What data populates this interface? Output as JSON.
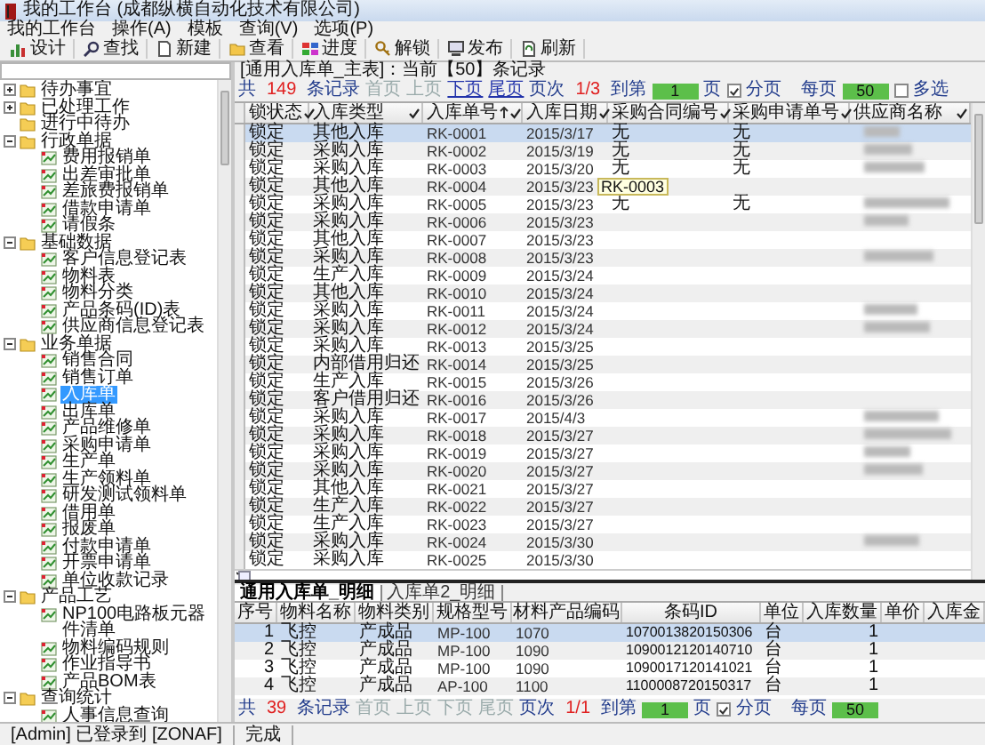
{
  "window": {
    "title": "我的工作台 (成都纵横自动化技术有限公司)"
  },
  "menu": [
    "我的工作台",
    "操作(A)",
    "模板",
    "查询(V)",
    "选项(P)"
  ],
  "toolbar": [
    "设计",
    "查找",
    "新建",
    "查看",
    "进度",
    "解锁",
    "发布",
    "刷新"
  ],
  "sidebar": {
    "tree": [
      {
        "label": "待办事宜",
        "kind": "folder",
        "expanded": false
      },
      {
        "label": "已处理工作",
        "kind": "folder",
        "expanded": false
      },
      {
        "label": "进行中待办",
        "kind": "folder"
      },
      {
        "label": "行政单据",
        "kind": "folder",
        "expanded": true,
        "children": [
          {
            "label": "费用报销单",
            "kind": "document",
            "selected": false
          },
          {
            "label": "出差审批单",
            "kind": "document",
            "selected": false
          },
          {
            "label": "差旅费报销单",
            "kind": "document",
            "selected": false
          },
          {
            "label": "借款申请单",
            "kind": "document",
            "selected": false
          },
          {
            "label": "请假条",
            "kind": "document",
            "selected": false
          }
        ]
      },
      {
        "label": "基础数据",
        "kind": "folder",
        "expanded": true,
        "children": [
          {
            "label": "客户信息登记表",
            "kind": "document",
            "selected": false
          },
          {
            "label": "物料表",
            "kind": "document",
            "selected": false
          },
          {
            "label": "物料分类",
            "kind": "document",
            "selected": false
          },
          {
            "label": "产品条码(ID)表",
            "kind": "document",
            "selected": false
          },
          {
            "label": "供应商信息登记表",
            "kind": "document",
            "selected": false
          }
        ]
      },
      {
        "label": "业务单据",
        "kind": "folder",
        "expanded": true,
        "children": [
          {
            "label": "销售合同",
            "kind": "document",
            "selected": false
          },
          {
            "label": "销售订单",
            "kind": "document",
            "selected": false
          },
          {
            "label": "入库单",
            "kind": "document",
            "selected": true
          },
          {
            "label": "出库单",
            "kind": "document",
            "selected": false
          },
          {
            "label": "产品维修单",
            "kind": "document",
            "selected": false
          },
          {
            "label": "采购申请单",
            "kind": "document",
            "selected": false
          },
          {
            "label": "生产单",
            "kind": "document",
            "selected": false
          },
          {
            "label": "生产领料单",
            "kind": "document",
            "selected": false
          },
          {
            "label": "研发测试领料单",
            "kind": "document",
            "selected": false
          },
          {
            "label": "借用单",
            "kind": "document",
            "selected": false
          },
          {
            "label": "报废单",
            "kind": "document",
            "selected": false
          },
          {
            "label": "付款申请单",
            "kind": "document",
            "selected": false
          },
          {
            "label": "开票申请单",
            "kind": "document",
            "selected": false
          },
          {
            "label": "单位收款记录",
            "kind": "document",
            "selected": false
          }
        ]
      },
      {
        "label": "产品工艺",
        "kind": "folder",
        "expanded": true,
        "children": [
          {
            "label": "NP100电路板元器件清单",
            "kind": "document",
            "selected": false
          },
          {
            "label": "物料编码规则",
            "kind": "document",
            "selected": false
          },
          {
            "label": "作业指导书",
            "kind": "document",
            "selected": false
          },
          {
            "label": "产品BOM表",
            "kind": "document",
            "selected": false
          }
        ]
      },
      {
        "label": "查询统计",
        "kind": "folder",
        "expanded": true,
        "children": [
          {
            "label": "人事信息查询",
            "kind": "document",
            "selected": false
          }
        ]
      }
    ]
  },
  "master": {
    "caption": "[通用入库单_主表]：当前【50】条记录",
    "pager": {
      "prefix": "共",
      "total": "149",
      "records_label": "条记录",
      "links": [
        {
          "label": "首页",
          "disabled": true
        },
        {
          "label": "上页",
          "disabled": true
        },
        {
          "label": "下页",
          "disabled": false
        },
        {
          "label": "尾页",
          "disabled": false
        }
      ],
      "page_label": "页次",
      "page": "1/3",
      "goto_label": "到第",
      "goto_value": "1",
      "page_unit": "页",
      "paging": {
        "label": "分页",
        "checked": true
      },
      "per_page_label": "每页",
      "per_page": "50",
      "multi": {
        "label": "多选",
        "checked": false
      }
    },
    "columns": [
      {
        "label": "锁状态",
        "sorted": false
      },
      {
        "label": "入库类型",
        "sorted": false
      },
      {
        "label": "入库单号",
        "sorted": true
      },
      {
        "label": "入库日期",
        "sorted": false
      },
      {
        "label": "采购合同编号",
        "sorted": false
      },
      {
        "label": "采购申请单号",
        "sorted": false
      },
      {
        "label": "供应商名称",
        "sorted": false
      }
    ],
    "rows": [
      {
        "lock": "锁定",
        "type": "其他入库",
        "no": "RK-0001",
        "date": "2015/3/17",
        "contract": "无",
        "request": "无",
        "supplier_blurred": true,
        "selected": true
      },
      {
        "lock": "锁定",
        "type": "采购入库",
        "no": "RK-0002",
        "date": "2015/3/19",
        "contract": "无",
        "request": "无",
        "supplier_blurred": true,
        "selected": false
      },
      {
        "lock": "锁定",
        "type": "采购入库",
        "no": "RK-0003",
        "date": "2015/3/20",
        "contract": "无",
        "request": "无",
        "supplier_blurred": true,
        "selected": false
      },
      {
        "lock": "锁定",
        "type": "其他入库",
        "no": "RK-0004",
        "date": "2015/3/23",
        "tooltip": "RK-0003",
        "supplier_blurred": false,
        "selected": false
      },
      {
        "lock": "锁定",
        "type": "采购入库",
        "no": "RK-0005",
        "date": "2015/3/23",
        "contract": "无",
        "request": "无",
        "supplier_blurred": true,
        "selected": false
      },
      {
        "lock": "锁定",
        "type": "采购入库",
        "no": "RK-0006",
        "date": "2015/3/23",
        "supplier_blurred": true,
        "selected": false
      },
      {
        "lock": "锁定",
        "type": "其他入库",
        "no": "RK-0007",
        "date": "2015/3/23",
        "supplier_blurred": false,
        "selected": false
      },
      {
        "lock": "锁定",
        "type": "采购入库",
        "no": "RK-0008",
        "date": "2015/3/23",
        "supplier_blurred": true,
        "selected": false
      },
      {
        "lock": "锁定",
        "type": "生产入库",
        "no": "RK-0009",
        "date": "2015/3/24",
        "supplier_blurred": false,
        "selected": false
      },
      {
        "lock": "锁定",
        "type": "其他入库",
        "no": "RK-0010",
        "date": "2015/3/24",
        "supplier_blurred": false,
        "selected": false
      },
      {
        "lock": "锁定",
        "type": "采购入库",
        "no": "RK-0011",
        "date": "2015/3/24",
        "supplier_blurred": true,
        "selected": false
      },
      {
        "lock": "锁定",
        "type": "采购入库",
        "no": "RK-0012",
        "date": "2015/3/24",
        "supplier_blurred": true,
        "selected": false
      },
      {
        "lock": "锁定",
        "type": "采购入库",
        "no": "RK-0013",
        "date": "2015/3/25",
        "supplier_blurred": false,
        "selected": false
      },
      {
        "lock": "锁定",
        "type": "内部借用归还",
        "no": "RK-0014",
        "date": "2015/3/25",
        "supplier_blurred": false,
        "selected": false
      },
      {
        "lock": "锁定",
        "type": "生产入库",
        "no": "RK-0015",
        "date": "2015/3/26",
        "supplier_blurred": false,
        "selected": false
      },
      {
        "lock": "锁定",
        "type": "客户借用归还",
        "no": "RK-0016",
        "date": "2015/3/26",
        "supplier_blurred": false,
        "selected": false
      },
      {
        "lock": "锁定",
        "type": "采购入库",
        "no": "RK-0017",
        "date": "2015/4/3",
        "supplier_blurred": true,
        "selected": false
      },
      {
        "lock": "锁定",
        "type": "采购入库",
        "no": "RK-0018",
        "date": "2015/3/27",
        "supplier_blurred": true,
        "selected": false
      },
      {
        "lock": "锁定",
        "type": "采购入库",
        "no": "RK-0019",
        "date": "2015/3/27",
        "supplier_blurred": true,
        "selected": false
      },
      {
        "lock": "锁定",
        "type": "采购入库",
        "no": "RK-0020",
        "date": "2015/3/27",
        "supplier_blurred": true,
        "selected": false
      },
      {
        "lock": "锁定",
        "type": "其他入库",
        "no": "RK-0021",
        "date": "2015/3/27",
        "supplier_blurred": false,
        "selected": false
      },
      {
        "lock": "锁定",
        "type": "生产入库",
        "no": "RK-0022",
        "date": "2015/3/27",
        "supplier_blurred": false,
        "selected": false
      },
      {
        "lock": "锁定",
        "type": "生产入库",
        "no": "RK-0023",
        "date": "2015/3/27",
        "supplier_blurred": false,
        "selected": false
      },
      {
        "lock": "锁定",
        "type": "采购入库",
        "no": "RK-0024",
        "date": "2015/3/30",
        "supplier_blurred": true,
        "selected": false
      },
      {
        "lock": "锁定",
        "type": "采购入库",
        "no": "RK-0025",
        "date": "2015/3/30",
        "supplier_blurred": false,
        "selected": false
      }
    ]
  },
  "detail": {
    "tabs": [
      {
        "label": "通用入库单_明细",
        "selected": true
      },
      {
        "label": "入库单2_明细",
        "selected": false
      }
    ],
    "columns": [
      "序号",
      "物料名称",
      "物料类别",
      "规格型号",
      "材料产品编码",
      "条码ID",
      "单位",
      "入库数量",
      "单价",
      "入库金"
    ],
    "rows": [
      {
        "seq": "1",
        "name": "飞控",
        "category": "产成品",
        "model": "MP-100",
        "code": "1070",
        "barcode": "1070013820150306",
        "unit": "台",
        "qty": "1",
        "selected": true
      },
      {
        "seq": "2",
        "name": "飞控",
        "category": "产成品",
        "model": "MP-100",
        "code": "1090",
        "barcode": "1090012120140710",
        "unit": "台",
        "qty": "1",
        "selected": false
      },
      {
        "seq": "3",
        "name": "飞控",
        "category": "产成品",
        "model": "MP-100",
        "code": "1090",
        "barcode": "1090017120141021",
        "unit": "台",
        "qty": "1",
        "selected": false
      },
      {
        "seq": "4",
        "name": "飞控",
        "category": "产成品",
        "model": "AP-100",
        "code": "1100",
        "barcode": "1100008720150317",
        "unit": "台",
        "qty": "1",
        "selected": false
      }
    ],
    "pager": {
      "prefix": "共",
      "total": "39",
      "records_label": "条记录",
      "links": [
        {
          "label": "首页",
          "disabled": true
        },
        {
          "label": "上页",
          "disabled": true
        },
        {
          "label": "下页",
          "disabled": true
        },
        {
          "label": "尾页",
          "disabled": true
        }
      ],
      "page_label": "页次",
      "page": "1/1",
      "goto_label": "到第",
      "goto_value": "1",
      "page_unit": "页",
      "paging": {
        "label": "分页",
        "checked": true
      },
      "per_page_label": "每页",
      "per_page": "50"
    }
  },
  "status_bar": [
    "[Admin] 已登录到 [ZONAF]",
    "完成"
  ]
}
